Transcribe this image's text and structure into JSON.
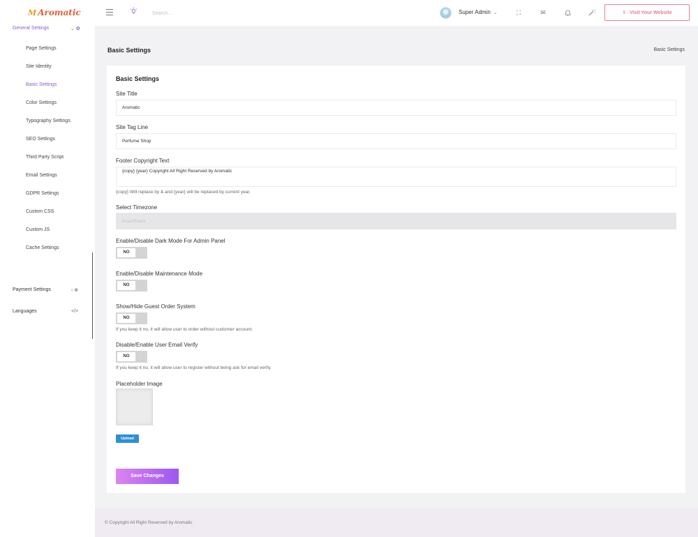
{
  "header": {
    "logo_mark": "M",
    "logo_text": "Aromatic",
    "search_placeholder": "Search...",
    "user_name": "Super Admin",
    "visit_label": "Visit Your Website"
  },
  "sidebar": {
    "group_label": "General Settings",
    "sub_items": [
      "Page Settings",
      "Site Identity",
      "Basic Settings",
      "Color Settings",
      "Typography Settings",
      "SEO Settings",
      "Third Party Script",
      "Email Settings",
      "GDPR Settings",
      "Custom CSS",
      "Custom JS",
      "Cache Settings"
    ],
    "active_item": "Basic Settings",
    "payment_label": "Payment Settings",
    "languages_label": "Languages"
  },
  "page": {
    "title": "Basic Settings",
    "breadcrumb": "Basic Settings"
  },
  "form": {
    "card_title": "Basic Settings",
    "site_title_label": "Site Title",
    "site_title_value": "Aromatic",
    "tag_line_label": "Site Tag Line",
    "tag_line_value": "Perfume Shop",
    "footer_label": "Footer Copyright Text",
    "footer_value": "{copy} {year} Copyright All Right Reserved by Aromatic",
    "footer_hint": "{copy} Will replace by & and {year} will be replaced by current year.",
    "timezone_label": "Select Timezone",
    "timezone_value": "Asia/Dhaka",
    "dark_mode_label": "Enable/Disable Dark Mode For Admin Panel",
    "dark_mode_value": "NO",
    "maintenance_label": "Enable/Disable Maintenance Mode",
    "maintenance_value": "NO",
    "guest_order_label": "Show/Hide Guest Order System",
    "guest_order_value": "NO",
    "guest_order_hint": "If you keep it no, it will allow user to order without customer account.",
    "email_verify_label": "Disable/Enable User Email Verify",
    "email_verify_value": "NO",
    "email_verify_hint": "If you keep it no, it will allow user to register without being ask for email verify.",
    "placeholder_label": "Placeholder Image",
    "upload_label": "Upload",
    "save_label": "Save Changes"
  },
  "footer": {
    "text": "© Copyright All Right Reserved by Aromatic"
  },
  "colors": {
    "accent": "#8b5ec9",
    "visit": "#f07b91",
    "upload": "#2d8fd6"
  }
}
